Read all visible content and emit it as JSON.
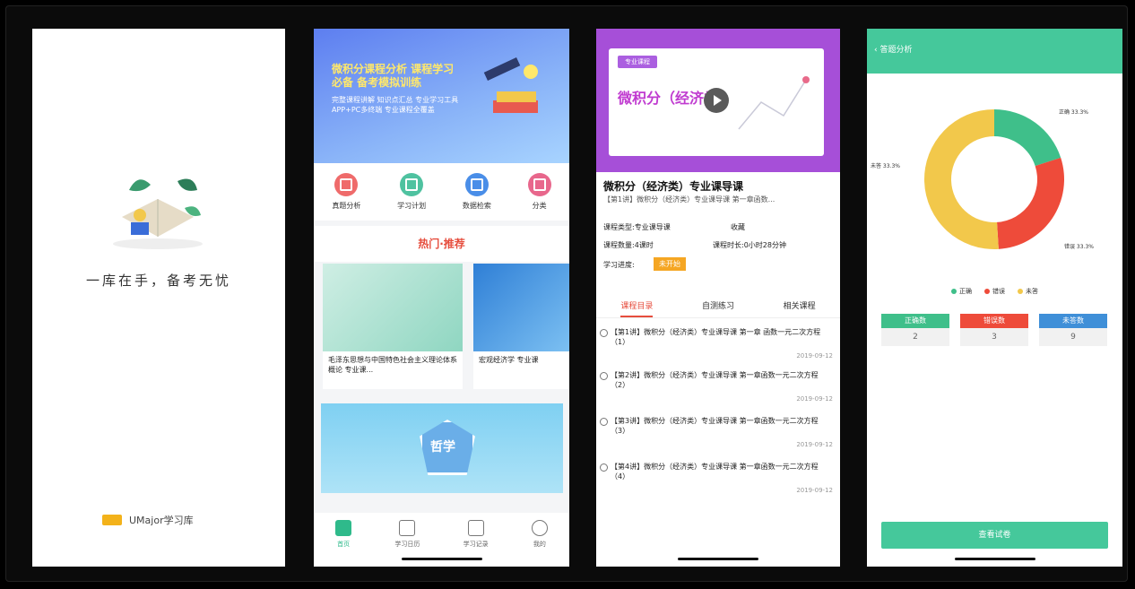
{
  "screen1": {
    "slogan": "一库在手，备考无忧",
    "brand": "UMajor学习库"
  },
  "screen2": {
    "banner_title": "微积分课程分析 课程学习必备 备考模拟训练",
    "banner_sub": "完整课程讲解 知识点汇总 专业学习工具 APP+PC多终端 专业课程全覆盖",
    "categories": [
      {
        "label": "真题分析",
        "color": "#ef6b6b"
      },
      {
        "label": "学习计划",
        "color": "#4fc2a0"
      },
      {
        "label": "数据检索",
        "color": "#4a8ee8"
      },
      {
        "label": "分类",
        "color": "#e8678c"
      }
    ],
    "section": "热门·推荐",
    "cards": [
      {
        "caption": "毛泽东思想与中国特色社会主义理论体系概论 专业课..."
      },
      {
        "caption": "宏观经济学 专业课"
      }
    ],
    "big_banner_label": "哲学",
    "tabs": [
      {
        "label": "首页"
      },
      {
        "label": "学习日历"
      },
      {
        "label": "学习记录"
      },
      {
        "label": "我的"
      }
    ]
  },
  "screen3": {
    "tag": "专业课程",
    "video_title": "微积分（经济类）",
    "title": "微积分（经济类）专业课导课",
    "subtitle": "【第1讲】微积分（经济类）专业课导课 第一章函数...",
    "meta": {
      "type": "课程类型:专业课导课",
      "collect": "收藏",
      "count": "课程数量:4课时",
      "duration": "课程时长:0小时28分钟",
      "progress_label": "学习进度:",
      "progress_badge": "未开始"
    },
    "tabs": [
      "课程目录",
      "自测练习",
      "相关课程"
    ],
    "lessons": [
      {
        "text": "【第1讲】微积分（经济类）专业课导课 第一章 函数一元二次方程（1）",
        "date": "2019-09-12"
      },
      {
        "text": "【第2讲】微积分（经济类）专业课导课 第一章函数一元二次方程（2）",
        "date": "2019-09-12"
      },
      {
        "text": "【第3讲】微积分（经济类）专业课导课 第一章函数一元二次方程（3）",
        "date": "2019-09-12"
      },
      {
        "text": "【第4讲】微积分（经济类）专业课导课 第一章函数一元二次方程 （4）",
        "date": "2019-09-12"
      }
    ]
  },
  "screen4": {
    "back_label": "答题分析",
    "pie_labels": [
      "正确 33.3%",
      "错误 33.3%",
      "未答 33.3%"
    ],
    "legend": [
      {
        "label": "正确",
        "color": "#3fbf8a"
      },
      {
        "label": "错误",
        "color": "#ee4b3a"
      },
      {
        "label": "未答",
        "color": "#f2c84b"
      }
    ],
    "stats": [
      {
        "label": "正确数",
        "value": "2",
        "color": "#3fbf8a"
      },
      {
        "label": "错误数",
        "value": "3",
        "color": "#ee4b3a"
      },
      {
        "label": "未答数",
        "value": "9",
        "color": "#3f8fd8"
      }
    ],
    "button": "查看试卷"
  },
  "chart_data": {
    "type": "pie",
    "labels": [
      "正确",
      "错误",
      "未答"
    ],
    "values": [
      20,
      29,
      51
    ],
    "colors": [
      "#3fbf8a",
      "#ee4b3a",
      "#f2c84b"
    ]
  }
}
